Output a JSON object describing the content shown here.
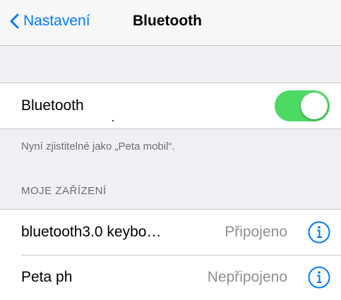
{
  "navbar": {
    "back_label": "Nastavení",
    "title": "Bluetooth"
  },
  "bluetooth_toggle": {
    "label": "Bluetooth",
    "enabled": true,
    "on_color": "#4cd964"
  },
  "discoverable_text": "Nyní zjistitelné jako „Peta mobil“.",
  "my_devices": {
    "header": "MOJE ZAŘÍZENÍ",
    "items": [
      {
        "name": "bluetooth3.0 keybo…",
        "status": "Připojeno"
      },
      {
        "name": "Peta ph",
        "status": "Nepřipojeno"
      }
    ]
  },
  "colors": {
    "accent": "#007aff",
    "background": "#efeff4",
    "secondary_text": "#6d6d72",
    "status_text": "#8e8e93"
  }
}
